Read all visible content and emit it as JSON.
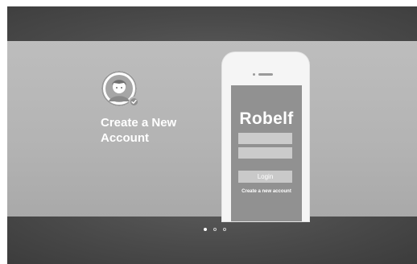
{
  "slide": {
    "title": "Create a New Account"
  },
  "phone": {
    "brand": "Robelf",
    "username_value": "",
    "password_value": "",
    "login_label": "Login",
    "create_link": "Create a new account"
  },
  "carousel": {
    "page_count": 3,
    "active_page": 1
  },
  "colors": {
    "slide_bg": "#b3b3b3",
    "bands_bg": "#474747",
    "phone_screen": "#919191",
    "text": "#ffffff"
  },
  "icons": {
    "avatar": "user-avatar-icon",
    "badge": "checkmark-icon"
  }
}
